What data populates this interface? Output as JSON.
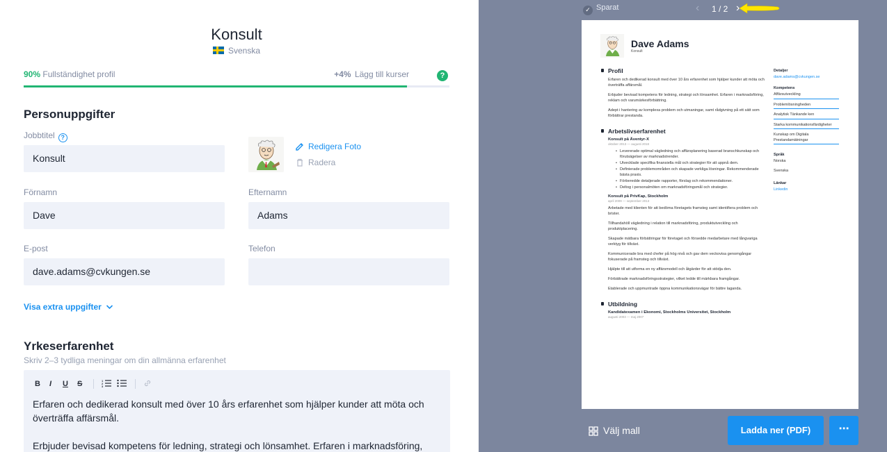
{
  "header": {
    "title": "Konsult",
    "language": "Svenska"
  },
  "progress": {
    "percent_label": "90%",
    "value": 0.9,
    "label": "Fullständighet profil",
    "gain_label": "+4%",
    "suggestion": "Lägg till kurser",
    "help": "?"
  },
  "personal": {
    "section_title": "Personuppgifter",
    "job_title_label": "Jobbtitel",
    "job_title_value": "Konsult",
    "edit_photo": "Redigera Foto",
    "delete_photo": "Radera",
    "first_name_label": "Förnamn",
    "first_name_value": "Dave",
    "last_name_label": "Efternamn",
    "last_name_value": "Adams",
    "email_label": "E-post",
    "email_value": "dave.adams@cvkungen.se",
    "phone_label": "Telefon",
    "phone_value": "",
    "show_extra": "Visa extra uppgifter"
  },
  "experience": {
    "section_title": "Yrkeserfarenhet",
    "subtitle": "Skriv 2–3 tydliga meningar om din allmänna erfarenhet",
    "toolbar": {
      "bold": "B",
      "italic": "I",
      "underline": "U",
      "strike": "S"
    },
    "paragraphs": [
      "Erfaren och dedikerad konsult med över 10 års erfarenhet som hjälper kunder att möta och överträffa affärsmål.",
      "Erbjuder bevisad kompetens för ledning, strategi och lönsamhet. Erfaren i marknadsföring,"
    ]
  },
  "preview": {
    "saved": "Sparat",
    "page_indicator": "1 / 2",
    "template_button": "Välj mall",
    "download_button": "Ladda ner (PDF)",
    "more_button": "⋯"
  },
  "cv": {
    "name": "Dave Adams",
    "role": "Konsult",
    "profile_heading": "Profil",
    "profile": [
      "Erfaren och dedikerad konsult med över 10 års erfarenhet som hjälper kunder att möta och överträffa affärsmål.",
      "Erbjuder bevisad kompetens för ledning, strategi och lönsamhet. Erfaren i marknadsföring, reklam och varumärkesförbättring.",
      "Adept i hantering av komplexa problem och utmaningar, samt rådgivning på ett sätt som förbättrar prestanda."
    ],
    "work_heading": "Arbetslivserfarenhet",
    "jobs": [
      {
        "title": "Konsult på Äventyr-X",
        "date": "oktober 2013 — augusti 2018",
        "bullets": [
          "Levererade optimal vägledning och affärsplanering baserad branschkunskap och förutsägelser av marknadstrender.",
          "Utvecklade specifika finansiella mål och strategier för att uppnå dem.",
          "Definierade problemområden och skapade verkliga lösningar. Rekommenderade bästa praxis.",
          "Förberedde detaljerade rapporter, förslag och rekommendationer.",
          "Deltog i personalmöten om marknadsföringsmål och strategier."
        ]
      },
      {
        "title": "Konsult på PrivKap, Stockholm",
        "date": "april 2009 — september 2013",
        "paragraphs": [
          "Arbetade med klienten för att bedöma företagets framsteg samt identifiera problem och brister.",
          "Tillhandahöll vägledning i relation till marknadsföring, produktutveckling och produktplacering.",
          "Skapade mätbara förbättringar för företaget och försedde medarbetare med långvariga verktyg för tillväxt.",
          "Kommunicerade bra med chefer på hög nivå och gav dem veckovisa genomgångar fokuserade på framsteg och tillväxt.",
          "Hjälpte till att utforma en ny affärsmodell och åtgärder för att stödja den.",
          "Förbättrade marknadsföringsstrategier, vilket ledde till märkbara framgångar.",
          "Etablerade och uppmuntrade öppna kommunikationsvägar för bättre laganda."
        ]
      }
    ],
    "education_heading": "Utbildning",
    "education": {
      "title": "Kandidatexamen i Ekonomi, Stockholms Universitet, Stockholm",
      "date": "augusti 2003 — maj 2007"
    },
    "side": {
      "details_heading": "Detaljer",
      "email": "dave.adams@cvkungen.se",
      "skills_heading": "Kompetens",
      "skills": [
        "Affärsutveckling",
        "Problemlösningheden",
        "Analytisk Tänkande ken",
        "Starka kommunikationsfärdigheter",
        "Kunskap om Digitala Prestandamätningar"
      ],
      "languages_heading": "Språk",
      "languages": [
        "Norska",
        "Svenska"
      ],
      "links_heading": "Länkar",
      "link": "Linkedin"
    }
  },
  "colors": {
    "accent_blue": "#1a91f0",
    "accent_green": "#21b573",
    "preview_bg": "#7c869e",
    "field_bg": "#eff2f9",
    "arrow_yellow": "#ffe600"
  }
}
